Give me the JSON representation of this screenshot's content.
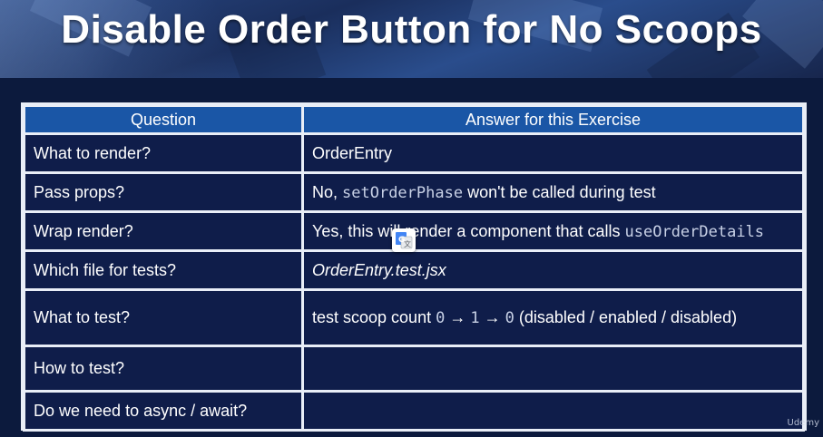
{
  "slide": {
    "title": "Disable Order Button for No Scoops"
  },
  "table": {
    "headers": [
      "Question",
      "Answer for this Exercise"
    ],
    "rows": [
      {
        "question": "What to render?",
        "answer": "OrderEntry"
      },
      {
        "question": "Pass props?",
        "answer_pre": "No, ",
        "answer_code": "setOrderPhase",
        "answer_post": " won't be called during test"
      },
      {
        "question": "Wrap render?",
        "answer_pre": "Yes, this will render a component that calls ",
        "answer_code": "useOrderDetails"
      },
      {
        "question": "Which file for tests?",
        "answer": "OrderEntry.test.jsx"
      },
      {
        "question": "What to test?",
        "answer_pre": "test scoop count ",
        "answer_code1": "0",
        "arrow1": "→",
        "answer_code2": "1",
        "arrow2": "→",
        "answer_code3": "0",
        "answer_post": " (disabled / enabled / disabled)"
      },
      {
        "question": "How to test?",
        "answer": ""
      },
      {
        "question": "Do we need to async / await?",
        "answer": ""
      }
    ]
  },
  "overlay": {
    "icon": "google-translate-icon",
    "watermark": "Udemy"
  }
}
